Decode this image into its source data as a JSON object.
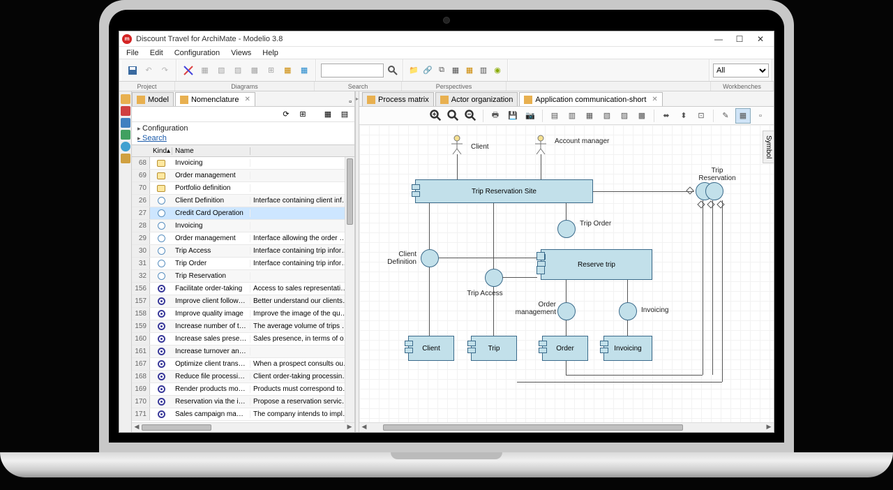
{
  "titlebar": {
    "title": "Discount Travel for ArchiMate - Modelio 3.8"
  },
  "menu": {
    "file": "File",
    "edit": "Edit",
    "configuration": "Configuration",
    "views": "Views",
    "help": "Help"
  },
  "toolbar_groups": {
    "project": "Project",
    "diagrams": "Diagrams",
    "search": "Search",
    "perspectives": "Perspectives",
    "workbenches": "Workbenches"
  },
  "workbench_select": "All",
  "left_tabs": {
    "model": "Model",
    "nomenclature": "Nomenclature"
  },
  "tree": {
    "configuration": "Configuration",
    "search": "Search"
  },
  "columns": {
    "kind": "Kind",
    "name": "Name"
  },
  "rows": [
    {
      "n": "68",
      "k": "rect",
      "name": "Invoicing",
      "desc": ""
    },
    {
      "n": "69",
      "k": "rect",
      "name": "Order management",
      "desc": ""
    },
    {
      "n": "70",
      "k": "rect",
      "name": "Portfolio definition",
      "desc": ""
    },
    {
      "n": "26",
      "k": "circle",
      "name": "Client Definition",
      "desc": "Interface containing client informat"
    },
    {
      "n": "27",
      "k": "circle",
      "name": "Credit Card Operation",
      "desc": ""
    },
    {
      "n": "28",
      "k": "circle",
      "name": "Invoicing",
      "desc": ""
    },
    {
      "n": "29",
      "k": "circle",
      "name": "Order management",
      "desc": "Interface allowing the order manag"
    },
    {
      "n": "30",
      "k": "circle",
      "name": "Trip Access",
      "desc": "Interface containing trip informatio"
    },
    {
      "n": "31",
      "k": "circle",
      "name": "Trip Order",
      "desc": "Interface containing trip informatio"
    },
    {
      "n": "32",
      "k": "circle",
      "name": "Trip Reservation",
      "desc": ""
    },
    {
      "n": "156",
      "k": "target",
      "name": "Facilitate order-taking",
      "desc": "Access to sales representatives and"
    },
    {
      "n": "157",
      "k": "target",
      "name": "Improve client follow-up",
      "desc": "Better understand our clients, their"
    },
    {
      "n": "158",
      "k": "target",
      "name": "Improve quality image",
      "desc": "Improve the image of the quality of"
    },
    {
      "n": "159",
      "k": "target",
      "name": "Increase number of trips r...",
      "desc": "The average volume of trips sold pe"
    },
    {
      "n": "160",
      "k": "target",
      "name": "Increase sales presence",
      "desc": "Sales presence, in terms of opening"
    },
    {
      "n": "161",
      "k": "target",
      "name": "Increase turnover and pro...",
      "desc": ""
    },
    {
      "n": "167",
      "k": "target",
      "name": "Optimize client transform...",
      "desc": "When a prospect consults our offer"
    },
    {
      "n": "168",
      "k": "target",
      "name": "Reduce file processing ti...",
      "desc": "Client order-taking processing time"
    },
    {
      "n": "169",
      "k": "target",
      "name": "Render products more att...",
      "desc": "Products must correspond to client"
    },
    {
      "n": "170",
      "k": "target",
      "name": "Reservation via the internet",
      "desc": "Propose a reservation service on the"
    },
    {
      "n": "171",
      "k": "target",
      "name": "Sales campaign manage...",
      "desc": "The company intends to implemen"
    }
  ],
  "right_tabs": {
    "process_matrix": "Process matrix",
    "actor_org": "Actor organization",
    "app_comm": "Application communication-short"
  },
  "side_tab": "Symbol",
  "diagram": {
    "actor_client": "Client",
    "actor_manager": "Account manager",
    "trip_reservation_site": "Trip Reservation Site",
    "trip_reservation": "Trip Reservation",
    "trip_order": "Trip Order",
    "reserve_trip": "Reserve trip",
    "client_definition": "Client Definition",
    "trip_access": "Trip Access",
    "order_management": "Order management",
    "invoicing_label": "Invoicing",
    "comp_client": "Client",
    "comp_trip": "Trip",
    "comp_order": "Order",
    "comp_invoicing": "Invoicing"
  }
}
